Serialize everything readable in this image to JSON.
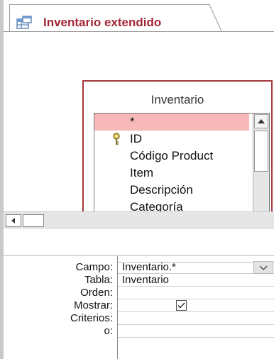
{
  "tab": {
    "title": "Inventario extendido",
    "icon": "query-icon"
  },
  "table": {
    "name": "Inventario",
    "fields": [
      {
        "name": "*",
        "selected": true,
        "key": false
      },
      {
        "name": "ID",
        "selected": false,
        "key": true
      },
      {
        "name": "Código Product",
        "selected": false,
        "key": false
      },
      {
        "name": "Item",
        "selected": false,
        "key": false
      },
      {
        "name": "Descripción",
        "selected": false,
        "key": false
      },
      {
        "name": "Categoría",
        "selected": false,
        "key": false
      }
    ]
  },
  "grid": {
    "row_labels": {
      "campo": "Campo:",
      "tabla": "Tabla:",
      "orden": "Orden:",
      "mostrar": "Mostrar:",
      "criterios": "Criterios:",
      "o": "o:"
    },
    "column": {
      "campo": "Inventario.*",
      "tabla": "Inventario",
      "orden": "",
      "mostrar": true,
      "criterios": "",
      "o": ""
    }
  },
  "colors": {
    "accent": "#a32735",
    "selection": "#f6b8b8",
    "table_border": "#a43a3f"
  }
}
